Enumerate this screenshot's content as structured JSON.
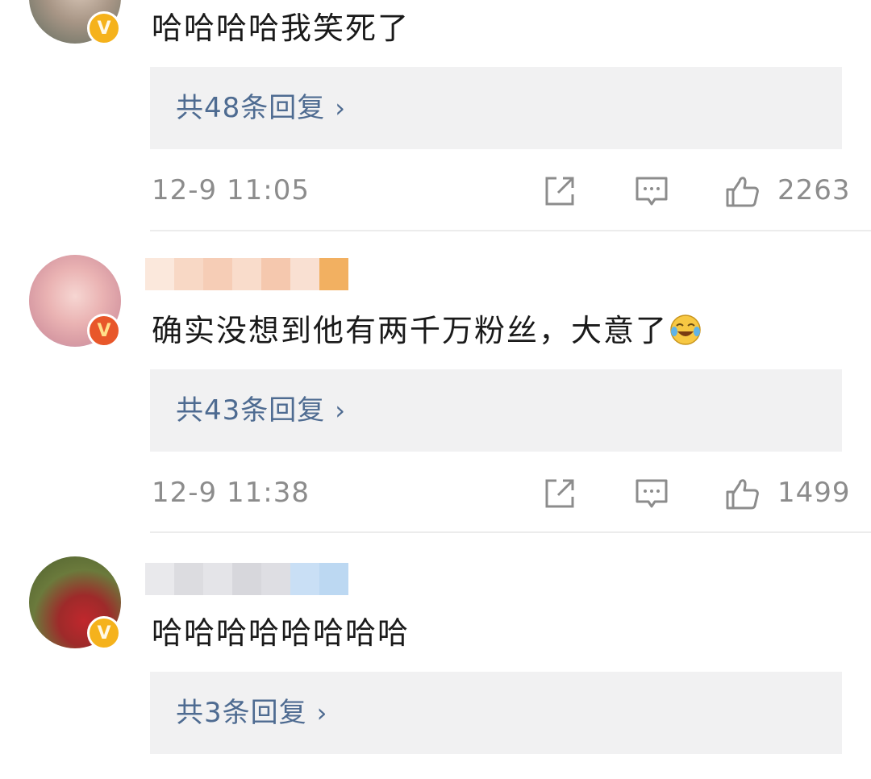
{
  "comments": [
    {
      "text": "哈哈哈哈我笑死了",
      "reply_label": "共48条回复",
      "reply_chevron": "›",
      "time": "12-9 11:05",
      "likes": "2263",
      "badge": "V",
      "badge_color": "#f5b21c"
    },
    {
      "text": "确实没想到他有两千万粉丝，大意了",
      "emoji": "crying-laughing-emoji",
      "reply_label": "共43条回复",
      "reply_chevron": "›",
      "time": "12-9 11:38",
      "likes": "1499",
      "badge": "V",
      "badge_color": "#e8572a"
    },
    {
      "text": "哈哈哈哈哈哈哈哈",
      "reply_label": "共3条回复",
      "reply_chevron": "›",
      "badge": "V",
      "badge_color": "#f5b21c"
    }
  ],
  "icons": {
    "share": "share-icon",
    "comment": "comment-icon",
    "like": "thumbs-up-icon"
  },
  "colors": {
    "link": "#4e6b91",
    "meta": "#8c8c8c",
    "reply_bg": "#f1f1f2"
  }
}
